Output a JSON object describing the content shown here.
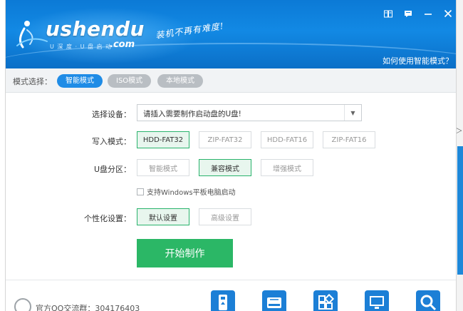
{
  "window": {
    "brand_name": "ushendu",
    "brand_domain": ".com",
    "brand_sub": "U 深 度 · U 盘 启 动",
    "slogan": "装机不再有难度!",
    "help_link": "如何使用智能模式？",
    "controls": [
      "book-icon",
      "feedback-icon",
      "minimize-icon",
      "close-icon"
    ]
  },
  "mode_bar": {
    "label": "模式选择：",
    "modes": [
      {
        "label": "智能模式",
        "active": true
      },
      {
        "label": "ISO模式",
        "active": false
      },
      {
        "label": "本地模式",
        "active": false
      }
    ]
  },
  "form": {
    "device_label": "选择设备：",
    "device_value": "请插入需要制作启动盘的U盘!",
    "write_mode_label": "写入模式：",
    "write_modes": [
      {
        "label": "HDD-FAT32",
        "selected": true
      },
      {
        "label": "ZIP-FAT32",
        "selected": false
      },
      {
        "label": "HDD-FAT16",
        "selected": false
      },
      {
        "label": "ZIP-FAT16",
        "selected": false
      }
    ],
    "partition_label": "U盘分区：",
    "partitions": [
      {
        "label": "智能模式",
        "selected": false
      },
      {
        "label": "兼容模式",
        "selected": true
      },
      {
        "label": "增强模式",
        "selected": false
      }
    ],
    "tablet_checkbox": "支持Windows平板电脑启动",
    "personal_label": "个性化设置：",
    "personal_options": [
      {
        "label": "默认设置",
        "selected": true
      },
      {
        "label": "高级设置",
        "selected": false
      }
    ],
    "start_button": "开始制作"
  },
  "footer": {
    "qq_text": "官方QQ交流群：304176403",
    "tools": [
      "usb-upgrade-icon",
      "hard-disk-icon",
      "app-grid-icon",
      "monitor-icon",
      "search-icon"
    ]
  },
  "colors": {
    "header_blue": "#1289e4",
    "active_pill": "#1f8ce6",
    "selected_green": "#29b36c",
    "start_green": "#2bb766"
  }
}
